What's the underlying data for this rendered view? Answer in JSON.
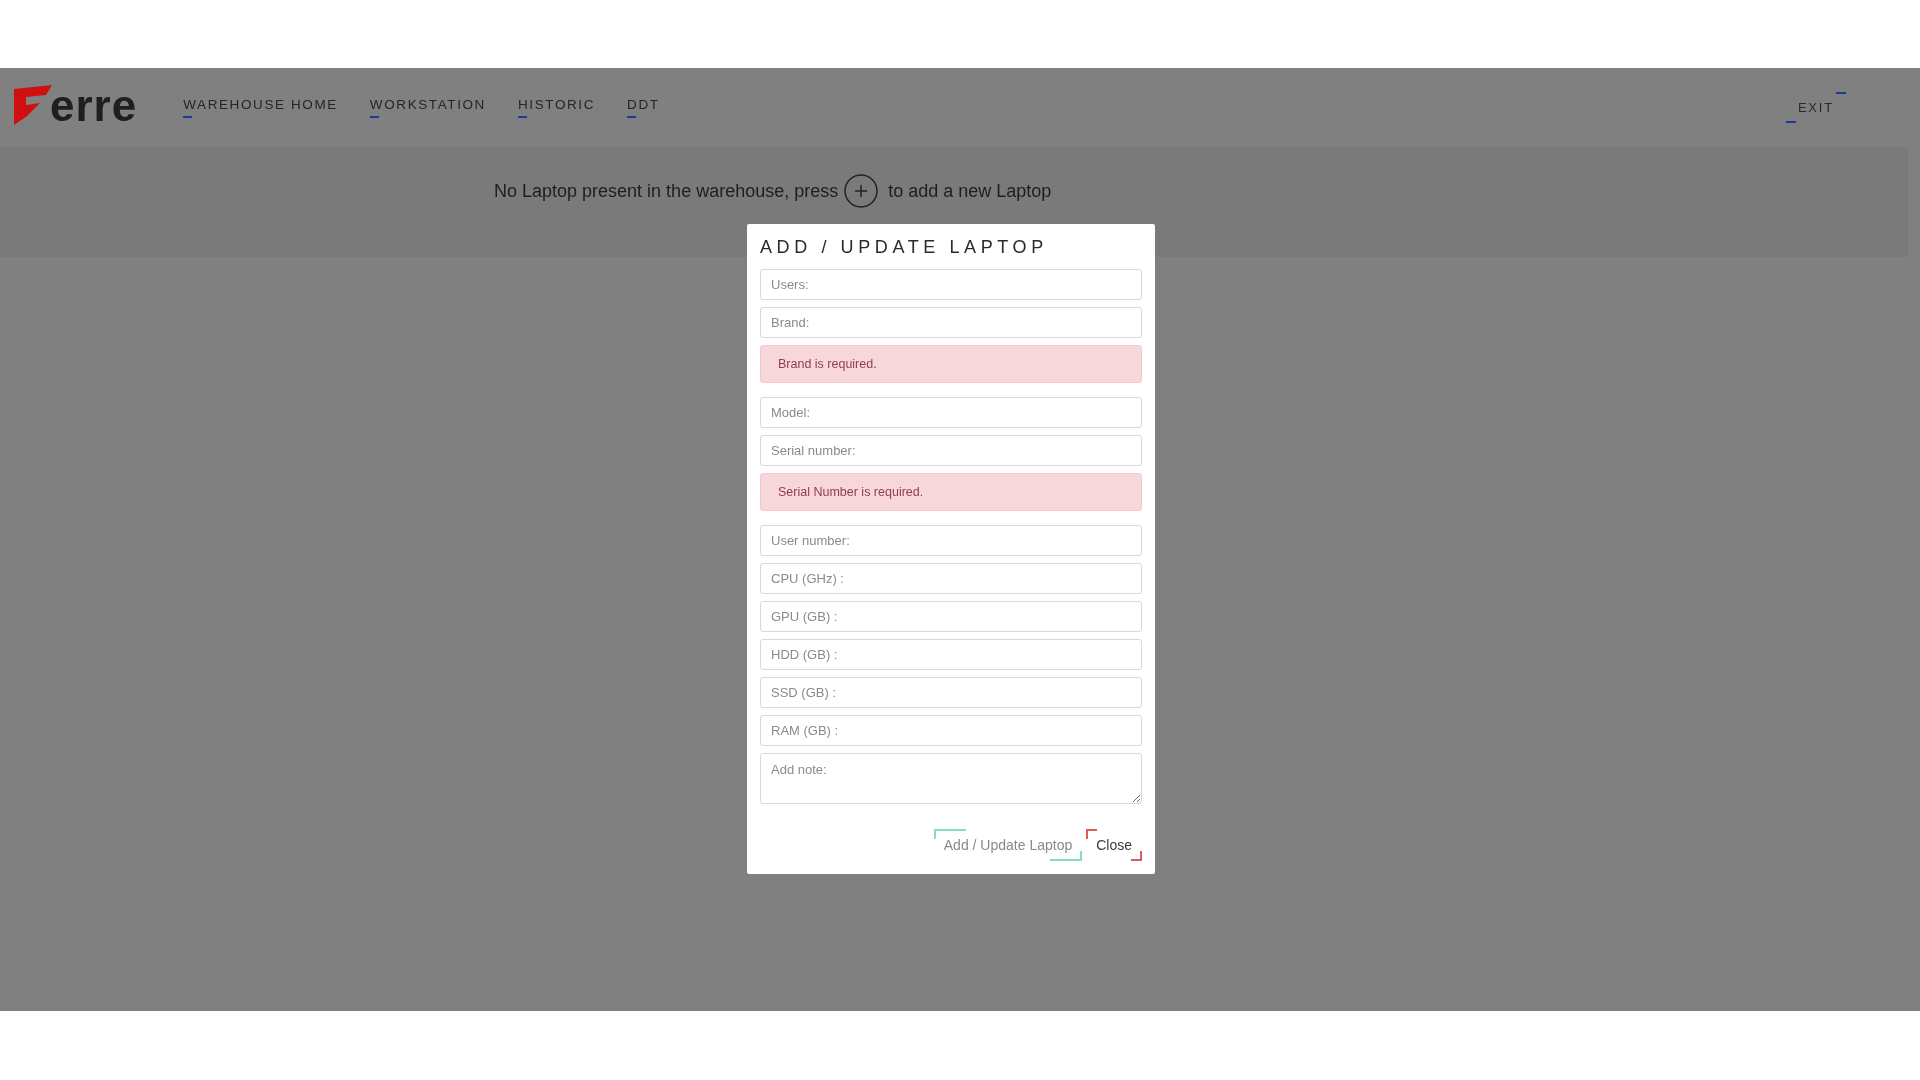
{
  "header": {
    "logo_text": "erre",
    "nav_links": [
      {
        "label": "WAREHOUSE HOME"
      },
      {
        "label": "WORKSTATION"
      },
      {
        "label": "HISTORIC"
      },
      {
        "label": "DDT"
      }
    ],
    "exit_label": "EXIT"
  },
  "empty_message": {
    "before": "No Laptop present in the warehouse, press",
    "after": "to add a new Laptop"
  },
  "dialog": {
    "title": "ADD / UPDATE LAPTOP",
    "fields": [
      {
        "kind": "input",
        "placeholder": "Users:"
      },
      {
        "kind": "input",
        "placeholder": "Brand:"
      },
      {
        "kind": "alert",
        "text": "Brand is required."
      },
      {
        "kind": "input",
        "placeholder": "Model:"
      },
      {
        "kind": "input",
        "placeholder": "Serial number:"
      },
      {
        "kind": "alert",
        "text": "Serial Number is required."
      },
      {
        "kind": "input",
        "placeholder": "User number:"
      },
      {
        "kind": "input",
        "placeholder": "CPU (GHz) :"
      },
      {
        "kind": "input",
        "placeholder": "GPU (GB) :"
      },
      {
        "kind": "input",
        "placeholder": "HDD (GB) :"
      },
      {
        "kind": "input",
        "placeholder": "SSD (GB) :"
      },
      {
        "kind": "input",
        "placeholder": "RAM (GB) :"
      },
      {
        "kind": "textarea",
        "placeholder": "Add note:"
      }
    ],
    "buttons": [
      {
        "kind": "submit",
        "label": "Add / Update Laptop"
      },
      {
        "kind": "close",
        "label": "Close"
      }
    ]
  }
}
